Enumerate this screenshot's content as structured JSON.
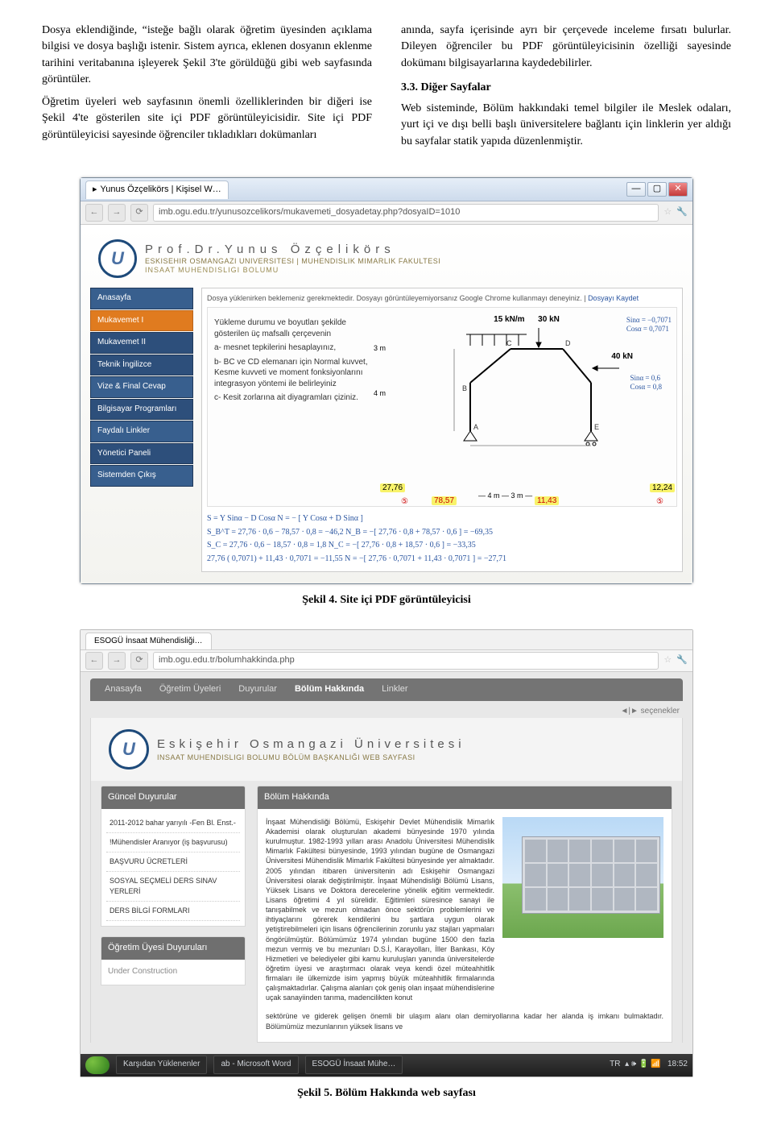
{
  "colLeft": {
    "p1": "Dosya eklendiğinde, “isteğe bağlı olarak öğretim üyesinden açıklama bilgisi ve dosya başlığı istenir. Sistem ayrıca, eklenen dosyanın eklenme tarihini veritabanına işleyerek Şekil 3'te görüldüğü gibi web sayfasında görüntüler.",
    "p2": "Öğretim üyeleri web sayfasının önemli özelliklerinden bir diğeri ise Şekil 4'te gösterilen site içi PDF görüntüleyicisidir. Site içi PDF görüntüleyicisi sayesinde öğrenciler tıkladıkları dokümanları"
  },
  "colRight": {
    "p1": "anında, sayfa içerisinde ayrı bir çerçevede inceleme fırsatı bulurlar. Dileyen öğrenciler bu PDF görüntüleyicisinin özelliği sayesinde dokümanı bilgisayarlarına kaydedebilirler.",
    "h": "3.3. Diğer Sayfalar",
    "p2": "Web sisteminde, Bölüm hakkındaki temel bilgiler ile Meslek odaları, yurt içi ve dışı belli başlı üniversitelere bağlantı için linklerin yer aldığı bu sayfalar statik yapıda düzenlenmiştir."
  },
  "fig4": {
    "tabTitle": "Yunus Özçelikörs | Kişisel W…",
    "url": "imb.ogu.edu.tr/yunusozcelikors/mukavemeti_dosyadetay.php?dosyaID=1010",
    "brandName": "Prof.Dr.Yunus Özçelikörs",
    "brandSub1": "ESKISEHIR OSMANGAZI UNIVERSITESI | MUHENDISLIK MIMARLIK FAKULTESI",
    "brandSub2": "INSAAT MUHENDISLIGI BOLUMU",
    "nav": {
      "n0": "Anasayfa",
      "n1": "Mukavemet I",
      "n2": "Mukavemet II",
      "n3": "Teknik İngilizce",
      "n4": "Vize & Final Cevap",
      "n5": "Bilgisayar Programları",
      "n6": "Faydalı Linkler",
      "n7": "Yönetici Paneli",
      "n8": "Sistemden Çıkış"
    },
    "pdfMsgA": "Dosya yüklenirken beklemeniz gerekmektedir. Dosyayı görüntüleyemiyorsanız Google Chrome kullanmayı deneyiniz. | ",
    "pdfMsgB": "Dosyayı Kaydet",
    "problem": {
      "intro": "Yükleme durumu ve boyutları şekilde gösterilen üç mafsallı çerçevenin",
      "a": "a- mesnet tepkilerini hesaplayınız,",
      "b": "b- BC ve CD elemanarı için Normal kuvvet, Kesme kuvveti ve moment fonksiyonlarını integrasyon yöntemi ile belirleyiniz",
      "c": "c- Kesit zorlarına ait diyagramları çiziniz."
    },
    "annot": {
      "load1": "15 kN/m",
      "load2": "30 kN",
      "load3": "40 kN",
      "sina": "Sinα = −0,7071",
      "cosa": "Cosα = 0,7071",
      "sina2": "Sinα = 0,6",
      "cosa2": "Cosα = 0,8",
      "d3a": "3 m",
      "d3b": "3 m",
      "d4": "4 m",
      "d4b": "4 m",
      "d3c": "3 m",
      "y1": "27,76",
      "y2": "78,57",
      "y3": "11,43",
      "y4": "12,24",
      "y5": "5",
      "eq1": "S =   Y Sinα  − D  Cosα                         N = − [ Y Cosα + D Sinα ]",
      "eq2": "S_B^T = 27,76 · 0,6 − 78,57 · 0,8 = −46,2          N_B = −[ 27,76 · 0,8 + 78,57 · 0,6 ] = −69,35",
      "eq3": "S_C  = 27,76 · 0,6 − 18,57 · 0,8 =  1,8            N_C = −[ 27,76 · 0,8 + 18,57 · 0,6 ] = −33,35",
      "eq4": "       27,76 ( 0,7071) + 11,43 · 0,7071 = −11,55    N  = −[ 27,76 · 0,7071 + 11,43 · 0,7071 ] = −27,71"
    },
    "caption": "Şekil 4. Site içi PDF görüntüleyicisi"
  },
  "fig5": {
    "tabTitle": "ESOGÜ İnsaat Mühendisliği…",
    "url": "imb.ogu.edu.tr/bolumhakkinda.php",
    "nav": {
      "a": "Anasayfa",
      "b": "Öğretim Üyeleri",
      "c": "Duyurular",
      "d": "Bölüm Hakkında",
      "e": "Linkler"
    },
    "opt": "seçenekler",
    "uniA": "Eskişehir Osmangazi Üniversitesi",
    "uniB": "INSAAT MUHENDISLIGI BOLUMU  BÖLÜM BAŞKANLIĞI WEB SAYFASI",
    "sideA": {
      "title": "Güncel Duyurular",
      "i0": "2011-2012 bahar yarıyılı -Fen Bl. Enst.-",
      "i1": "!Mühendisler Aranıyor (iş başvurusu)",
      "i2": "BAŞVURU ÜCRETLERİ",
      "i3": "SOSYAL SEÇMELİ DERS SINAV YERLERİ",
      "i4": "DERS BİLGİ FORMLARI"
    },
    "sideB": {
      "title": "Öğretim Üyesi Duyuruları",
      "uc": "Under Construction"
    },
    "mainTitle": "Bölüm Hakkında",
    "mainText": "İnşaat Mühendisliği Bölümü, Eskişehir Devlet Mühendislik Mimarlık Akademisi olarak oluşturulan akademi bünyesinde 1970 yılında kurulmuştur. 1982-1993 yılları arası Anadolu Üniversitesi Mühendislik Mimarlık Fakültesi bünyesinde, 1993 yılından bugüne de Osmangazi Üniversitesi Mühendislik Mimarlık Fakültesi bünyesinde yer almaktadır. 2005 yılından itibaren üniversitenin adı Eskişehir Osmangazi Üniversitesi olarak değiştirilmiştir.\n\nİnşaat Mühendisliği Bölümü Lisans, Yüksek Lisans ve Doktora derecelerine yönelik eğitim vermektedir. Lisans öğretimi 4 yıl sürelidir. Eğitimleri süresince sanayi ile tanışabilmek ve mezun olmadan önce sektörün problemlerini ve ihtiyaçlarını görerek kendilerini bu şartlara uygun olarak yetiştirebilmeleri için lisans öğrencilerinin zorunlu yaz stajları yapmaları öngörülmüştür.\n\nBölümümüz 1974 yılından bugüne 1500 den fazla mezun vermiş ve bu mezunları D.S.İ, Karayolları, İller Bankası, Köy Hizmetleri ve belediyeler gibi kamu kuruluşları yanında üniversitelerde öğretim üyesi ve araştırmacı olarak veya kendi özel müteahhitlik firmaları ile ülkemizde isim yapmış büyük müteahhitlik firmalarında çalışmaktadırlar. Çalışma alanları çok geniş olan inşaat mühendislerine uçak sanayiinden tarıma, madencilikten konut",
    "mainCut": "sektörüne ve giderek gelişen önemli bir ulaşım alanı olan demiryollarına kadar her alanda iş imkanı bulmaktadır. Bölümümüz mezunlarının yüksek lisans ve",
    "task": {
      "a": "Karşıdan Yüklenenler",
      "b": "ab - Microsoft Word",
      "c": "ESOGÜ İnsaat Mühe…",
      "clock": "18:52",
      "lang": "TR"
    },
    "caption": "Şekil 5. Bölüm Hakkında web sayfası"
  }
}
